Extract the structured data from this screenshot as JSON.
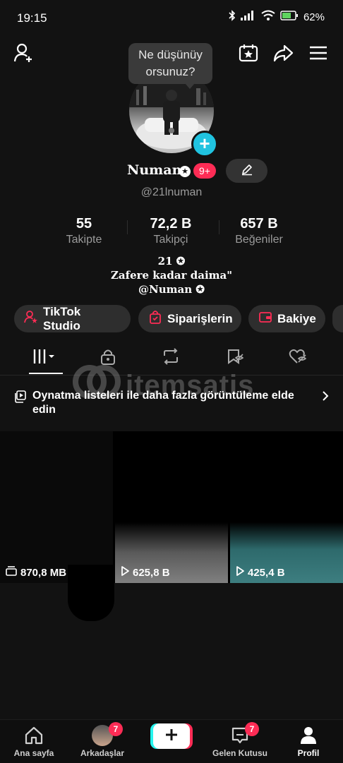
{
  "status_bar": {
    "time": "19:15",
    "battery": "62%"
  },
  "bubble": {
    "text_line1": "Ne düşünüy",
    "text_line2": "orsunuz?"
  },
  "profile": {
    "name": "Numan",
    "notif_badge": "9+",
    "username": "@21lnuman",
    "stats": [
      {
        "value": "55",
        "label": "Takipte"
      },
      {
        "value": "72,2 B",
        "label": "Takipçi"
      },
      {
        "value": "657 B",
        "label": "Beğeniler"
      }
    ],
    "bio": [
      "21 ✪",
      "Zafere kadar daima\"",
      "@Numan ✪"
    ]
  },
  "pills": [
    "TikTok Studio",
    "Siparişlerin",
    "Bakiye"
  ],
  "watermark": "itemsatis",
  "playlist_text": "Oynatma listeleri ile daha fazla görüntüleme elde edin",
  "videos": [
    {
      "caption": "870,8 MB",
      "icon": "storage-icon"
    },
    {
      "caption": "625,8 B",
      "icon": "play-icon"
    },
    {
      "caption": "425,4 B",
      "icon": "play-icon"
    }
  ],
  "nav": {
    "home": "Ana sayfa",
    "friends": "Arkadaşlar",
    "friends_count": "7",
    "inbox": "Gelen Kutusu",
    "inbox_count": "7",
    "profile": "Profil"
  },
  "colors": {
    "accent": "#fe2c55",
    "cyan": "#20c3e0"
  }
}
